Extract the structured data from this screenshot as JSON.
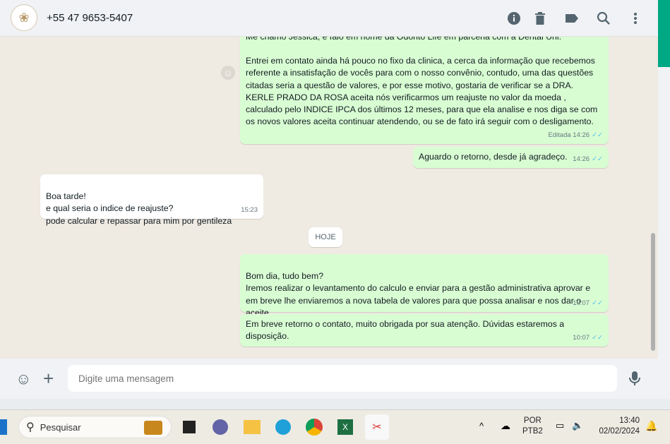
{
  "header": {
    "contact": "+55 47 9653-5407",
    "icons": [
      "info-icon",
      "trash-icon",
      "label-icon",
      "search-icon",
      "menu-icon"
    ]
  },
  "messages": [
    {
      "dir": "out",
      "lines": [
        "Me chamo Jessica, e falo em nome da Odonto Life em parceria com a Dental Uni.",
        "",
        "Entrei em contato ainda há pouco no fixo da clinica, a cerca da informação que recebemos referente a insatisfação de vocês para com o nosso convênio, contudo, uma das questões citadas seria a questão de valores, e por esse motivo, gostaria de verificar se a DRA. KERLE PRADO DA ROSA aceita nós verificarmos um reajuste no valor da moeda , calculado pelo INDICE IPCA dos últimos 12 meses, para que ela analise e nos diga se com os novos valores aceita continuar atendendo, ou se de fato irá seguir com o desligamento."
      ],
      "meta": "Editada 14:26"
    },
    {
      "dir": "out",
      "text": "Aguardo o retorno, desde já agradeço.",
      "meta": "14:26"
    },
    {
      "dir": "in",
      "text": "Boa tarde!\ne qual seria o indice de reajuste?\npode calcular e repassar para mim por gentileza",
      "meta": "15:23"
    },
    {
      "dir": "out",
      "text": "Bom dia, tudo bem?\nIremos realizar o levantamento do calculo e enviar para a gestão administrativa aprovar e em breve lhe enviaremos a nova tabela de valores para que possa analisar e nos dar o aceite.",
      "meta": "10:07"
    },
    {
      "dir": "out",
      "text": "Em breve retorno o contato, muito obrigada por sua atenção. Dúvidas estaremos a disposição.",
      "meta": "10:07"
    }
  ],
  "date_chip": "HOJE",
  "composer": {
    "placeholder": "Digite uma mensagem"
  },
  "taskbar": {
    "search": "Pesquisar",
    "lang1": "POR",
    "lang2": "PTB2",
    "time": "13:40",
    "date": "02/02/2024"
  }
}
